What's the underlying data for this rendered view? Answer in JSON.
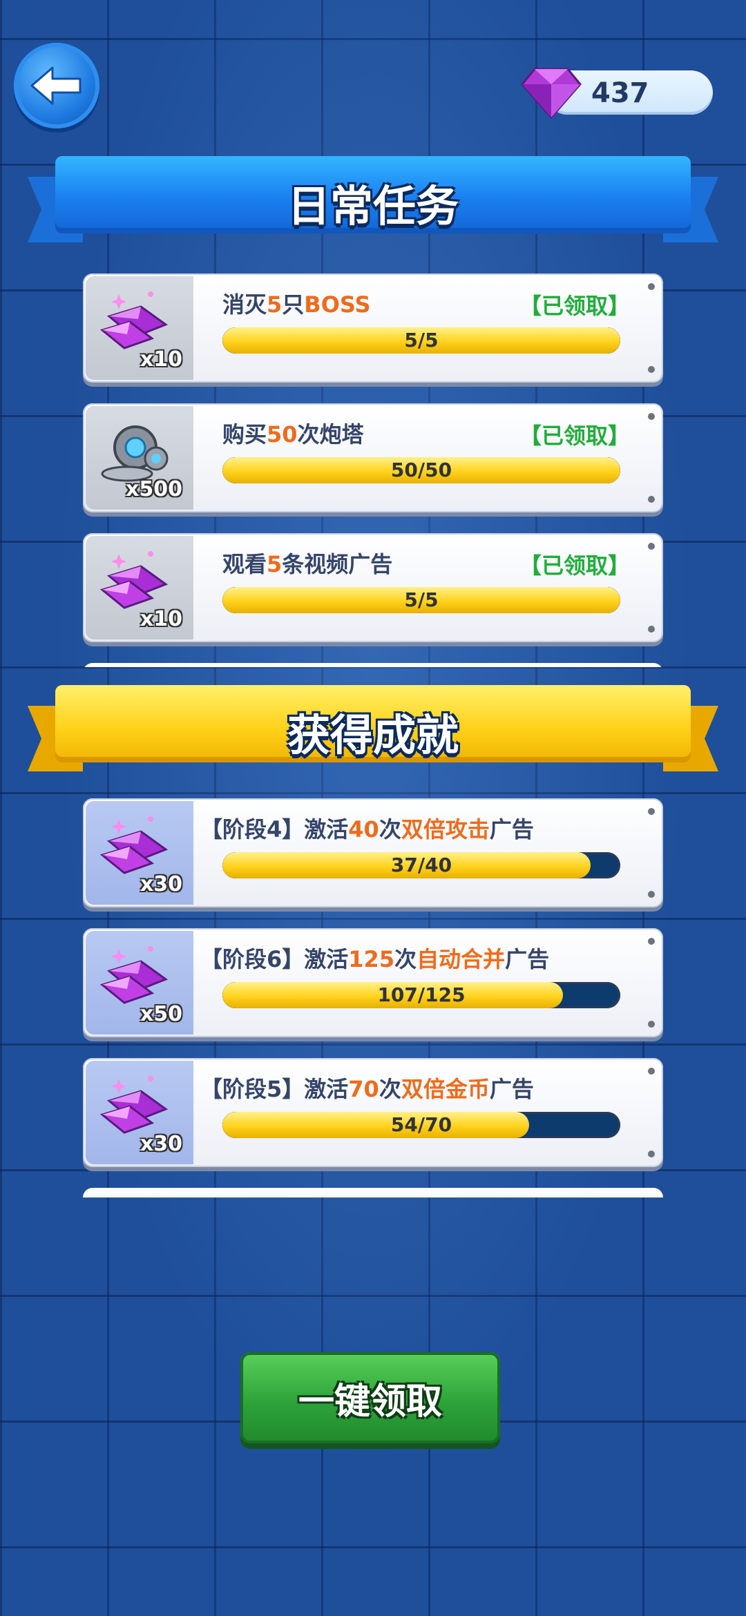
{
  "header": {
    "gems": "437"
  },
  "daily": {
    "title": "日常任务",
    "tasks": [
      {
        "pre": "消灭",
        "hl": "5",
        "post": "只",
        "hl2": "BOSS",
        "post2": "",
        "reward": "x10",
        "reward_icon": "gem-icon",
        "status": "【已领取】",
        "progress_text": "5/5",
        "progress": 1.0
      },
      {
        "pre": "购买",
        "hl": "50",
        "post": "次炮塔",
        "hl2": "",
        "post2": "",
        "reward": "x500",
        "reward_icon": "gear-icon",
        "status": "【已领取】",
        "progress_text": "50/50",
        "progress": 1.0
      },
      {
        "pre": "观看",
        "hl": "5",
        "post": "条视频广告",
        "hl2": "",
        "post2": "",
        "reward": "x10",
        "reward_icon": "gem-icon",
        "status": "【已领取】",
        "progress_text": "5/5",
        "progress": 1.0
      }
    ]
  },
  "achievements": {
    "title": "获得成就",
    "items": [
      {
        "pre": "【阶段4】激活",
        "hl": "40",
        "post": "次",
        "hl2": "双倍攻击",
        "post2": "广告",
        "reward": "x30",
        "reward_icon": "gem-icon",
        "progress_text": "37/40",
        "progress": 0.925
      },
      {
        "pre": "【阶段6】激活",
        "hl": "125",
        "post": "次",
        "hl2": "自动合并",
        "post2": "广告",
        "reward": "x50",
        "reward_icon": "gem-icon",
        "progress_text": "107/125",
        "progress": 0.856
      },
      {
        "pre": "【阶段5】激活",
        "hl": "70",
        "post": "次",
        "hl2": "双倍金币",
        "post2": "广告",
        "reward": "x30",
        "reward_icon": "gem-icon",
        "progress_text": "54/70",
        "progress": 0.771
      }
    ]
  },
  "footer": {
    "claim_all_label": "一键领取"
  },
  "colors": {
    "highlight": "#f06a1a",
    "claimed": "#1fae3a",
    "progress_fill": "#ffd21c",
    "progress_track": "#0d3b6e"
  }
}
